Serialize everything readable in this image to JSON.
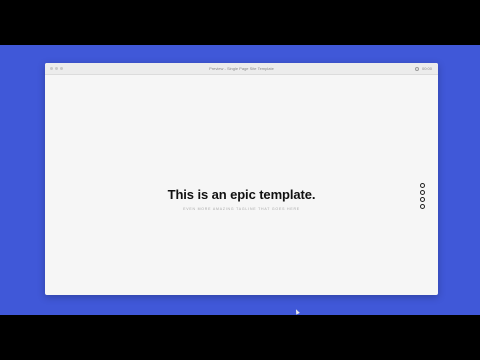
{
  "window": {
    "title": "Preview - Single Page Site Template",
    "clock": "00:00"
  },
  "hero": {
    "headline": "This is an epic template.",
    "tagline": "Even more amazing tagline that goes here"
  },
  "dot_nav": {
    "count": 4,
    "active_index": -1
  },
  "colors": {
    "background": "#4058d8",
    "window_bg": "#f6f6f6",
    "headline": "#111111",
    "tagline": "#a8a8a8"
  }
}
